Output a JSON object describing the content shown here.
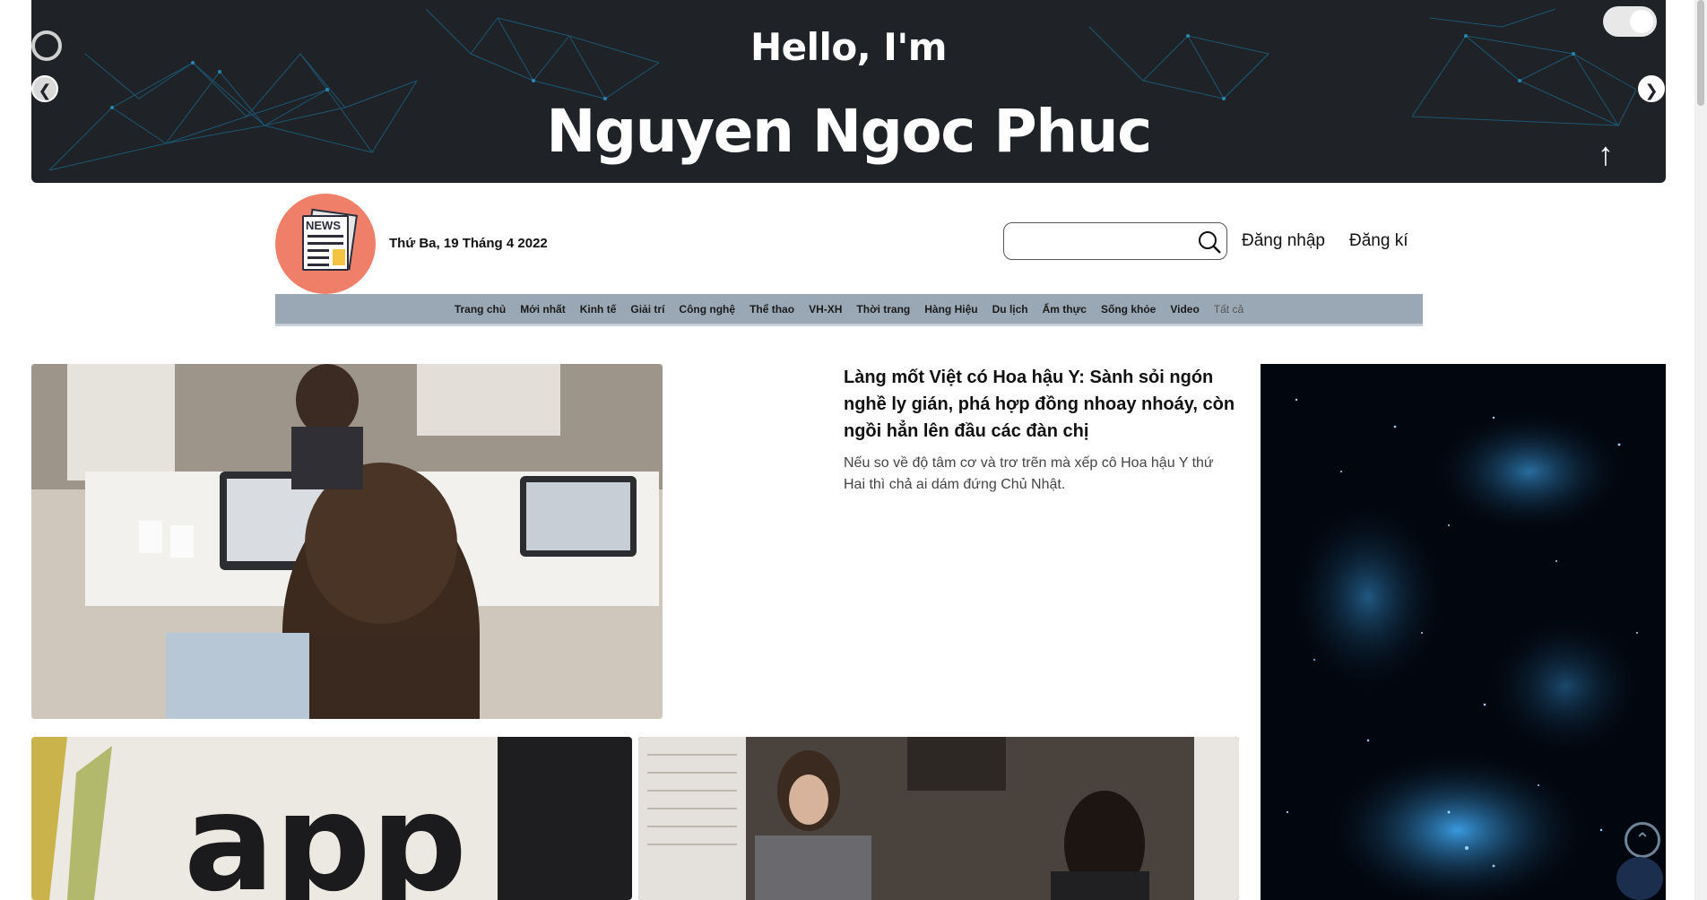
{
  "hero": {
    "greeting": "Hello, I'm",
    "name": "Nguyen Ngoc Phuc",
    "prev_icon": "chevron-left-icon",
    "next_icon": "chevron-right-icon",
    "up_icon": "arrow-up-icon",
    "toggle_state": "on"
  },
  "header": {
    "logo_text": "NEWS",
    "date": "Thứ Ba, 19 Tháng 4 2022",
    "search": {
      "value": "",
      "placeholder": ""
    },
    "login_label": "Đăng nhập",
    "register_label": "Đăng kí"
  },
  "nav": {
    "items": [
      "Trang chủ",
      "Mới nhất",
      "Kinh tế",
      "Giải trí",
      "Công nghệ",
      "Thể thao",
      "VH-XH",
      "Thời trang",
      "Hàng Hiệu",
      "Du lịch",
      "Ẩm thực",
      "Sống khỏe",
      "Video",
      "Tất cả"
    ]
  },
  "featured": {
    "title": "Làng mốt Việt có Hoa hậu Y: Sành sỏi ngón nghề ly gián, phá hợp đồng nhoay nhoáy, còn ngồi hẳn lên đầu các đàn chị",
    "excerpt": "Nếu so về độ tâm cơ và trơ trẽn mà xếp cô Hoa hậu Y thứ Hai thì chả ai dám đứng Chủ Nhật."
  },
  "photos": {
    "photo2_sign": "app"
  },
  "colors": {
    "hero_bg": "#1f2327",
    "nav_bg": "#9aa8b6",
    "logo_bg": "#f07f6a",
    "mesh": "#1d5f80"
  }
}
